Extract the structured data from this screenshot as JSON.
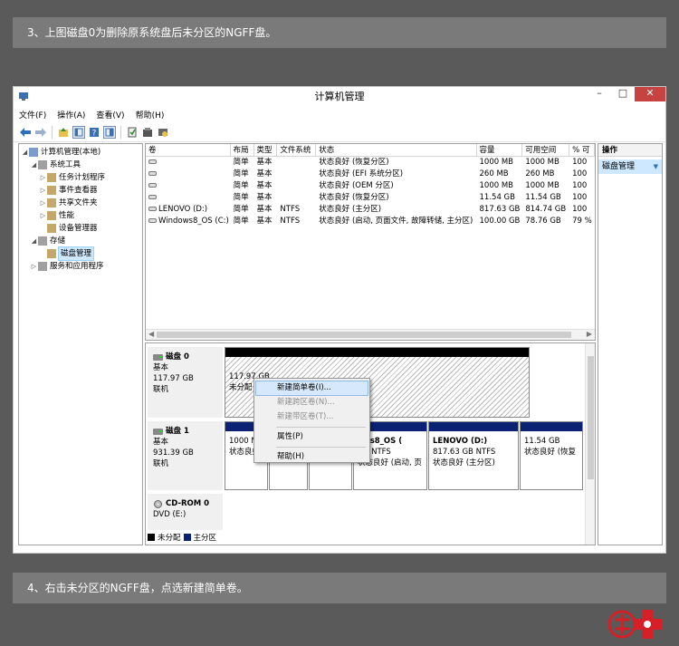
{
  "captions": {
    "top": "3、上图磁盘0为删除原系统盘后未分区的NGFF盘。",
    "bottom": "4、右击未分区的NGFF盘，点选新建简单卷。"
  },
  "window": {
    "title": "计算机管理",
    "controls": {
      "minimize": "–",
      "maximize": "□",
      "close": "✕"
    }
  },
  "menu": [
    "文件(F)",
    "操作(A)",
    "查看(V)",
    "帮助(H)"
  ],
  "tree": [
    {
      "label": "计算机管理(本地)",
      "indent": 0,
      "twisty": "◢",
      "selected": false
    },
    {
      "label": "系统工具",
      "indent": 1,
      "twisty": "◢",
      "selected": false
    },
    {
      "label": "任务计划程序",
      "indent": 2,
      "twisty": "▷",
      "selected": false
    },
    {
      "label": "事件查看器",
      "indent": 2,
      "twisty": "▷",
      "selected": false
    },
    {
      "label": "共享文件夹",
      "indent": 2,
      "twisty": "▷",
      "selected": false
    },
    {
      "label": "性能",
      "indent": 2,
      "twisty": "▷",
      "selected": false
    },
    {
      "label": "设备管理器",
      "indent": 2,
      "twisty": "",
      "selected": false
    },
    {
      "label": "存储",
      "indent": 1,
      "twisty": "◢",
      "selected": false
    },
    {
      "label": "磁盘管理",
      "indent": 2,
      "twisty": "",
      "selected": true
    },
    {
      "label": "服务和应用程序",
      "indent": 1,
      "twisty": "▷",
      "selected": false
    }
  ],
  "volume_table": {
    "headers": [
      "卷",
      "布局",
      "类型",
      "文件系统",
      "状态",
      "容量",
      "可用空间",
      "% 可"
    ],
    "rows": [
      [
        "",
        "简单",
        "基本",
        "",
        "状态良好 (恢复分区)",
        "1000 MB",
        "1000 MB",
        "100"
      ],
      [
        "",
        "简单",
        "基本",
        "",
        "状态良好 (EFI 系统分区)",
        "260 MB",
        "260 MB",
        "100"
      ],
      [
        "",
        "简单",
        "基本",
        "",
        "状态良好 (OEM 分区)",
        "1000 MB",
        "1000 MB",
        "100"
      ],
      [
        "",
        "简单",
        "基本",
        "",
        "状态良好 (恢复分区)",
        "11.54 GB",
        "11.54 GB",
        "100"
      ],
      [
        "LENOVO (D:)",
        "简单",
        "基本",
        "NTFS",
        "状态良好 (主分区)",
        "817.63 GB",
        "814.74 GB",
        "100"
      ],
      [
        "Windows8_OS (C:)",
        "简单",
        "基本",
        "NTFS",
        "状态良好 (启动, 页面文件, 故障转储, 主分区)",
        "100.00 GB",
        "78.76 GB",
        "79 %"
      ]
    ]
  },
  "disks": {
    "disk0": {
      "name": "磁盘 0",
      "type": "基本",
      "size": "117.97 GB",
      "state": "联机",
      "part_size": "117.97 GB",
      "part_state": "未分配"
    },
    "disk1": {
      "name": "磁盘 1",
      "type": "基本",
      "size": "931.39 GB",
      "state": "联机",
      "parts": [
        {
          "title": "",
          "size": "1000 MB",
          "state": "状态良好 ("
        },
        {
          "title": "",
          "size": "",
          "state": "状态良好"
        },
        {
          "title": "",
          "size": "",
          "state": "状态良好 ("
        },
        {
          "title": "ows8_OS (",
          "size": "GB NTFS",
          "state": "状态良好 (启动, 页"
        },
        {
          "title": "LENOVO  (D:)",
          "size": "817.63 GB NTFS",
          "state": "状态良好 (主分区)"
        },
        {
          "title": "",
          "size": "11.54 GB",
          "state": "状态良好 (恢复"
        }
      ]
    },
    "cdrom": {
      "name": "CD-ROM 0",
      "drive": "DVD (E:)"
    }
  },
  "legend": {
    "unallocated": "未分配",
    "primary": "主分区"
  },
  "ops": {
    "header": "操作",
    "item": "磁盘管理",
    "arrow": "▼"
  },
  "context_menu": {
    "new_simple": "新建简单卷(I)...",
    "new_spanned": "新建跨区卷(N)...",
    "new_striped": "新建带区卷(T)...",
    "properties": "属性(P)",
    "help": "帮助(H)"
  },
  "colors": {
    "primary_bar": "#0a2174",
    "unallocated_bar": "#000000",
    "close": "#c74341",
    "logo_red": "#d61f26"
  },
  "icons": [
    "app-icon",
    "back-icon",
    "forward-icon",
    "up-icon",
    "view-icon",
    "help-icon",
    "console-icon",
    "disk-icon",
    "cdrom-icon"
  ]
}
